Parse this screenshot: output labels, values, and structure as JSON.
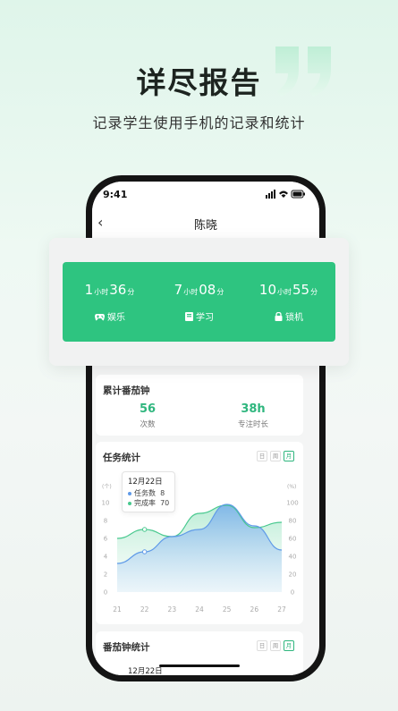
{
  "hero": {
    "title": "详尽报告",
    "subtitle": "记录学生使用手机的记录和统计"
  },
  "status_bar": {
    "time": "9:41"
  },
  "nav": {
    "back": "‹",
    "title": "陈晓"
  },
  "usage_summary": [
    {
      "hours": "1",
      "hours_unit": "小时",
      "minutes": "36",
      "minutes_unit": "分",
      "label": "娱乐",
      "icon": "gamepad-icon"
    },
    {
      "hours": "7",
      "hours_unit": "小时",
      "minutes": "08",
      "minutes_unit": "分",
      "label": "学习",
      "icon": "book-icon"
    },
    {
      "hours": "10",
      "hours_unit": "小时",
      "minutes": "55",
      "minutes_unit": "分",
      "label": "锁机",
      "icon": "lock-icon"
    }
  ],
  "pomodoro_total": {
    "title": "累计番茄钟",
    "count_value": "56",
    "count_label": "次数",
    "focus_value": "38h",
    "focus_label": "专注时长"
  },
  "task_stats": {
    "title": "任务统计",
    "segments": [
      "日",
      "周",
      "月"
    ],
    "active_segment": "月",
    "tooltip": {
      "date": "12月22日",
      "task_label": "任务数",
      "task_value": "8",
      "rate_label": "完成率",
      "rate_value": "70"
    },
    "left_unit": "(个)",
    "right_unit": "(%)"
  },
  "pomodoro_stats": {
    "title": "番茄钟统计",
    "segments": [
      "日",
      "周",
      "月"
    ],
    "tooltip_date": "12月22日"
  },
  "chart_data": {
    "type": "area",
    "categories": [
      "21",
      "22",
      "23",
      "24",
      "25",
      "26",
      "27"
    ],
    "y_left_ticks": [
      "10",
      "8",
      "6",
      "4",
      "2",
      "0"
    ],
    "y_right_ticks": [
      "100",
      "80",
      "60",
      "40",
      "20",
      "0"
    ],
    "ylim_left": [
      0,
      10
    ],
    "ylim_right": [
      0,
      100
    ],
    "series": [
      {
        "name": "任务数",
        "axis": "left",
        "values": [
          3.2,
          4.5,
          6.2,
          7.0,
          9.8,
          7.4,
          4.7
        ]
      },
      {
        "name": "完成率",
        "axis": "right",
        "values": [
          60,
          70,
          62,
          88,
          97,
          72,
          78
        ]
      }
    ],
    "colors": {
      "tasks": "#5f9ae8",
      "rate": "#49c98f"
    }
  }
}
